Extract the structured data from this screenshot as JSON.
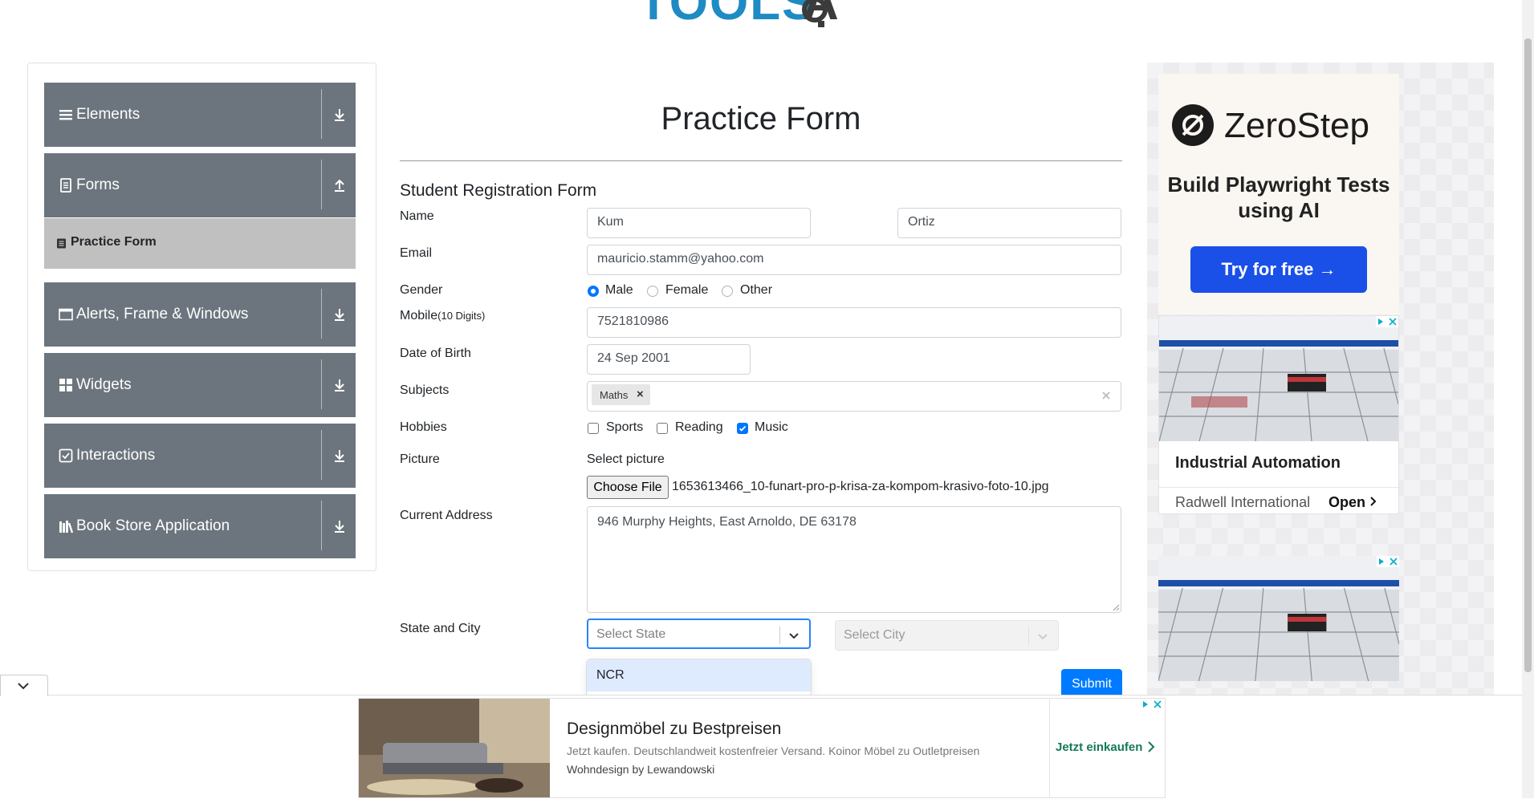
{
  "sidebar": {
    "groups": [
      {
        "label": "Elements",
        "icon": "list-icon",
        "arrow": "download-arrow-icon"
      },
      {
        "label": "Forms",
        "icon": "document-icon",
        "arrow": "upload-arrow-icon"
      },
      {
        "label": "Alerts, Frame & Windows",
        "icon": "window-icon",
        "arrow": "download-arrow-icon"
      },
      {
        "label": "Widgets",
        "icon": "grid-icon",
        "arrow": "download-arrow-icon"
      },
      {
        "label": "Interactions",
        "icon": "interaction-icon",
        "arrow": "download-arrow-icon"
      },
      {
        "label": "Book Store Application",
        "icon": "books-icon",
        "arrow": "download-arrow-icon"
      }
    ],
    "active_item": "Practice Form"
  },
  "form": {
    "page_title": "Practice Form",
    "form_title": "Student Registration Form",
    "labels": {
      "name": "Name",
      "email": "Email",
      "gender": "Gender",
      "mobile": "Mobile",
      "mobile_hint": "(10 Digits)",
      "dob": "Date of Birth",
      "subjects": "Subjects",
      "hobbies": "Hobbies",
      "picture": "Picture",
      "address": "Current Address",
      "state_city": "State and City"
    },
    "first_name": "Kum",
    "last_name": "Ortiz",
    "email": "mauricio.stamm@yahoo.com",
    "gender_options": [
      "Male",
      "Female",
      "Other"
    ],
    "gender_selected": "Male",
    "mobile": "7521810986",
    "dob": "24 Sep 2001",
    "subjects": [
      "Maths"
    ],
    "hobby_options": [
      "Sports",
      "Reading",
      "Music"
    ],
    "hobbies_checked": [
      "Music"
    ],
    "picture_label": "Select picture",
    "choose_file": "Choose File",
    "file_name": "1653613466_10-funart-pro-p-krisa-za-kompom-krasivo-foto-10.jpg",
    "address": "946 Murphy Heights, East Arnoldo, DE 63178",
    "state_placeholder": "Select State",
    "city_placeholder": "Select City",
    "state_menu_options": [
      "NCR"
    ],
    "submit": "Submit"
  },
  "ads": {
    "zerostep": {
      "brand": "ZeroStep",
      "tagline": "Build Playwright Tests using AI",
      "cta": "Try for free →"
    },
    "industrial": {
      "headline": "Industrial Automation",
      "source": "Radwell International",
      "cta": "Open"
    },
    "bottom": {
      "headline": "Designmöbel zu Bestpreisen",
      "description": "Jetzt kaufen. Deutschlandweit kostenfreier Versand. Koinor Möbel zu Outletpreisen",
      "source": "Wohndesign by Lewandowski",
      "cta": "Jetzt einkaufen"
    }
  },
  "colors": {
    "sidebar_group": "#6c757d",
    "active_item": "#c0c0c0",
    "primary": "#007bff",
    "zerostep_button": "#1a50e8",
    "logo_blue": "#1e8bc3"
  }
}
